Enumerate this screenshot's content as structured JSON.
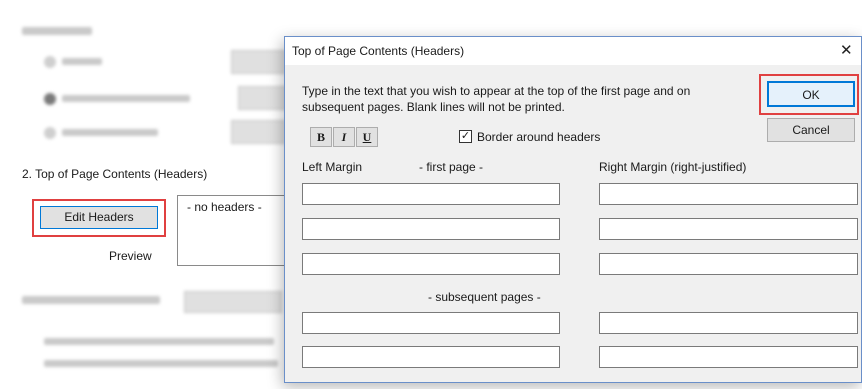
{
  "background": {
    "section2_label": "2. Top of Page Contents (Headers)",
    "edit_headers_label": "Edit Headers",
    "preview_text": "- no headers -",
    "preview_label": "Preview"
  },
  "dialog": {
    "title": "Top of Page Contents (Headers)",
    "close_glyph": "✕",
    "instructions": "Type in the text that you wish to appear at the top of the first page and on subsequent pages.  Blank lines will not be printed.",
    "ok_label": "OK",
    "cancel_label": "Cancel",
    "bold_label": "B",
    "italic_label": "I",
    "underline_label": "U",
    "border_checkbox": {
      "label": "Border around headers",
      "checked": true,
      "mark": "✓"
    },
    "left_margin_label": "Left Margin",
    "first_page_label": "- first page -",
    "right_margin_label": "Right Margin (right-justified)",
    "subsequent_pages_label": "- subsequent pages -",
    "first_page_fields": {
      "left": [
        "",
        "",
        ""
      ],
      "right": [
        "",
        "",
        ""
      ]
    },
    "subsequent_fields": {
      "left": [
        "",
        ""
      ],
      "right": [
        "",
        ""
      ]
    }
  },
  "colors": {
    "highlight": "#e04040",
    "dialog_border": "#6a8fc9",
    "ok_border": "#0078d7"
  }
}
